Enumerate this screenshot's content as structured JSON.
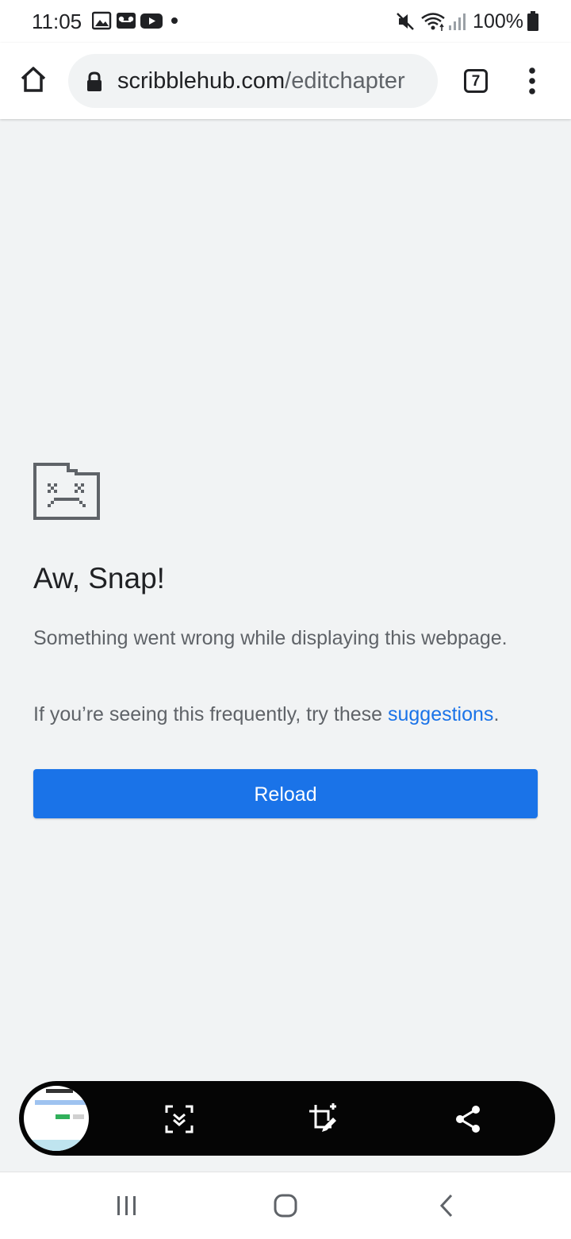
{
  "status_bar": {
    "time": "11:05",
    "battery": "100%",
    "left_icons": [
      "image-icon",
      "voicemail-icon",
      "youtube-icon",
      "dot-icon"
    ],
    "right_icons": [
      "mute-icon",
      "wifi-icon",
      "signal-icon",
      "battery-icon"
    ]
  },
  "toolbar": {
    "url_domain": "scribblehub.com",
    "url_path": "/editchapter",
    "tab_count": "7",
    "icons": [
      "home-icon",
      "lock-icon",
      "more-vert-icon"
    ]
  },
  "error_page": {
    "title": "Aw, Snap!",
    "message": "Something went wrong while displaying this webpage.",
    "hint_prefix": "If you’re seeing this frequently, try these ",
    "hint_link": "suggestions",
    "hint_suffix": ".",
    "reload_label": "Reload",
    "colors": {
      "accent": "#1a73e8",
      "background": "#f1f3f4"
    }
  },
  "capture_toolbar": {
    "icons": [
      "scroll-capture-icon",
      "crop-edit-icon",
      "share-icon"
    ]
  },
  "nav_bar": {
    "icons": [
      "recents-icon",
      "home-nav-icon",
      "back-icon"
    ]
  }
}
